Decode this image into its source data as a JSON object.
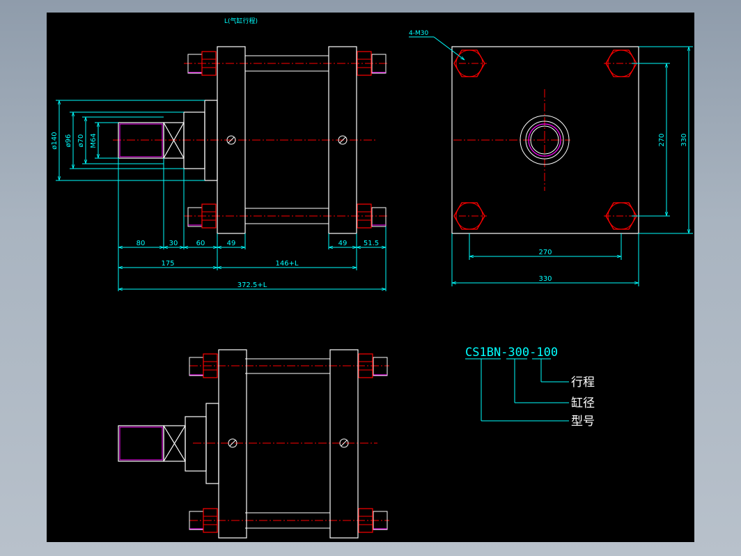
{
  "colors": {
    "background": "#000000",
    "outline": "#ffffff",
    "dimension": "#00ffff",
    "nut": "#ff0000",
    "centerline": "#ff0000",
    "rod": "#ff00ff"
  },
  "front_view": {
    "top_note": "L(气缸行程)",
    "dims": {
      "d140": "ø140",
      "d96": "ø96",
      "d70": "ø70",
      "m64": "M64",
      "d80": "80",
      "d30": "30",
      "d60": "60",
      "d49a": "49",
      "d49b": "49",
      "d515": "51.5",
      "d175": "175",
      "d146": "146+L",
      "d3725": "372.5+L"
    }
  },
  "end_view": {
    "bolt_note": "4-M30",
    "dims": {
      "h270": "270",
      "h330": "330",
      "v270": "270",
      "v330": "330"
    }
  },
  "legend": {
    "code": "CS1BN-300-100",
    "items": {
      "stroke": "行程",
      "bore": "缸径",
      "model": "型号"
    }
  }
}
